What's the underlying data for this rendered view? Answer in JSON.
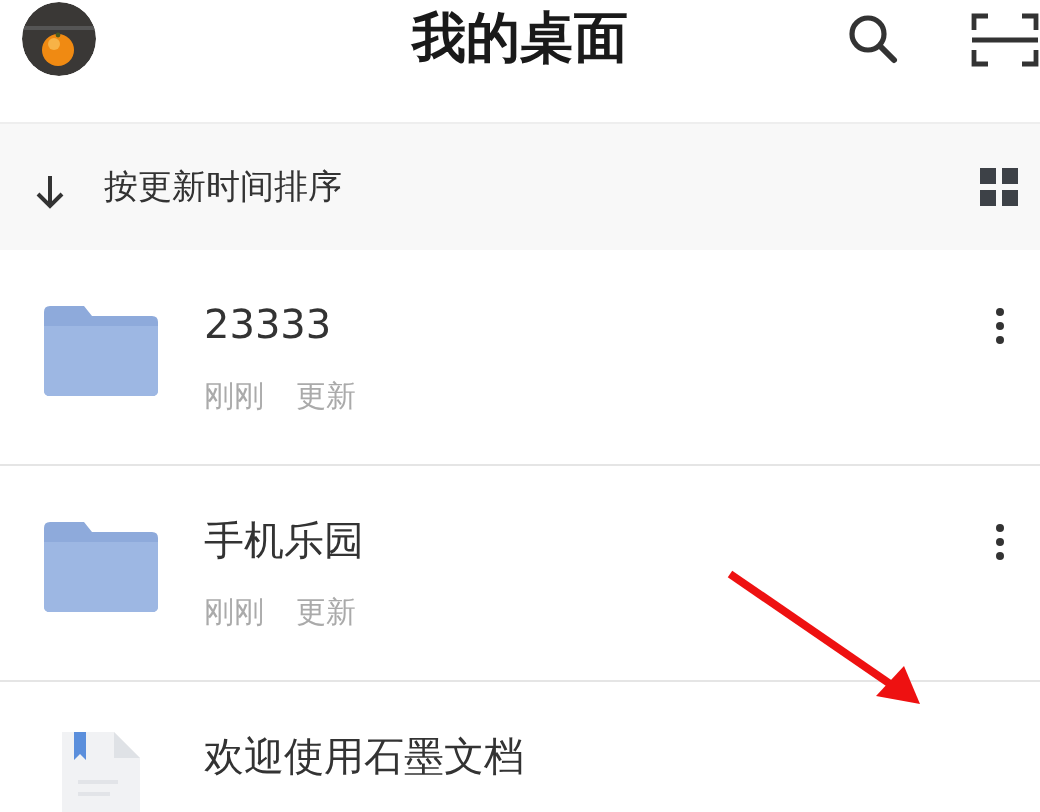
{
  "header": {
    "title": "我的桌面"
  },
  "sort_bar": {
    "label": "按更新时间排序"
  },
  "items": [
    {
      "kind": "folder",
      "name": "23333",
      "meta": [
        "刚刚",
        "更新"
      ]
    },
    {
      "kind": "folder",
      "name": "手机乐园",
      "meta": [
        "刚刚",
        "更新"
      ]
    },
    {
      "kind": "document",
      "name": "欢迎使用石墨文档"
    }
  ]
}
